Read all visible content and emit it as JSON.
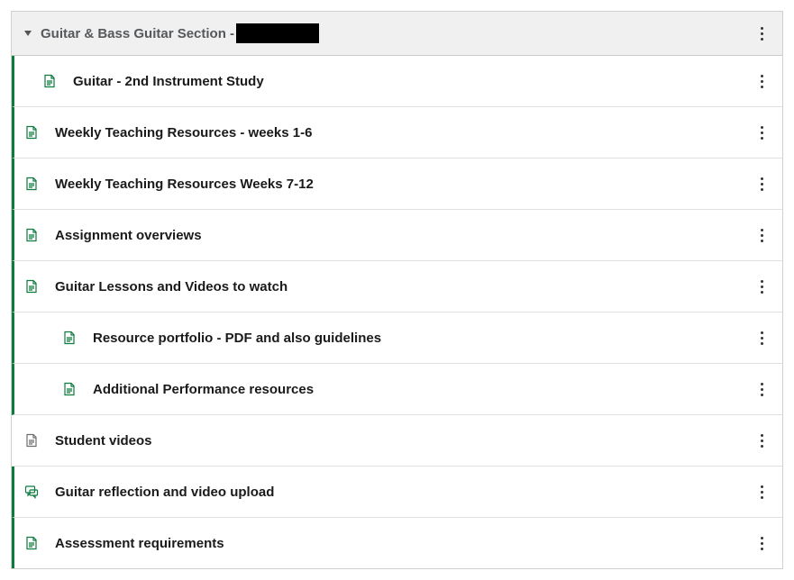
{
  "section": {
    "title_prefix": "Guitar & Bass Guitar Section -",
    "items": [
      {
        "label": "Guitar - 2nd Instrument Study",
        "indent": 1,
        "accent": true,
        "icon": "page-green"
      },
      {
        "label": "Weekly Teaching Resources - weeks 1-6",
        "indent": 0,
        "accent": true,
        "icon": "page-green"
      },
      {
        "label": "Weekly Teaching Resources Weeks 7-12",
        "indent": 0,
        "accent": true,
        "icon": "page-green"
      },
      {
        "label": "Assignment overviews",
        "indent": 0,
        "accent": true,
        "icon": "page-green"
      },
      {
        "label": "Guitar Lessons and Videos to watch",
        "indent": 0,
        "accent": true,
        "icon": "page-green"
      },
      {
        "label": "Resource portfolio - PDF and also guidelines",
        "indent": 2,
        "accent": true,
        "icon": "page-green"
      },
      {
        "label": "Additional Performance resources",
        "indent": 2,
        "accent": true,
        "icon": "page-green"
      },
      {
        "label": "Student videos",
        "indent": 0,
        "accent": false,
        "icon": "page-gray"
      },
      {
        "label": "Guitar reflection and video upload",
        "indent": 0,
        "accent": true,
        "icon": "discussion-green"
      },
      {
        "label": "Assessment requirements",
        "indent": 0,
        "accent": true,
        "icon": "page-green"
      }
    ]
  }
}
